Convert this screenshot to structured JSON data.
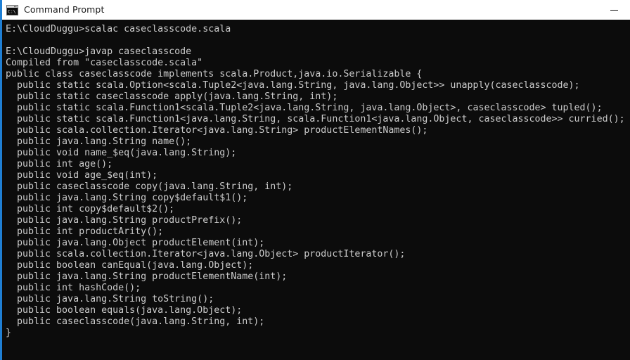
{
  "window": {
    "title": "Command Prompt",
    "icon": "console-window-icon",
    "icon_text": "C:\\",
    "accent_color": "#1f7fd4",
    "titlebar_bg": "#ffffff",
    "terminal_bg": "#0c0c0c",
    "terminal_fg": "#cccccc",
    "controls": [
      {
        "name": "minimize",
        "glyph": "—"
      }
    ]
  },
  "terminal": {
    "prompt_path": "E:\\CloudDuggu>",
    "lines": [
      "E:\\CloudDuggu>scalac caseclasscode.scala",
      "",
      "E:\\CloudDuggu>javap caseclasscode",
      "Compiled from \"caseclasscode.scala\"",
      "public class caseclasscode implements scala.Product,java.io.Serializable {",
      "  public static scala.Option<scala.Tuple2<java.lang.String, java.lang.Object>> unapply(caseclasscode);",
      "  public static caseclasscode apply(java.lang.String, int);",
      "  public static scala.Function1<scala.Tuple2<java.lang.String, java.lang.Object>, caseclasscode> tupled();",
      "  public static scala.Function1<java.lang.String, scala.Function1<java.lang.Object, caseclasscode>> curried();",
      "  public scala.collection.Iterator<java.lang.String> productElementNames();",
      "  public java.lang.String name();",
      "  public void name_$eq(java.lang.String);",
      "  public int age();",
      "  public void age_$eq(int);",
      "  public caseclasscode copy(java.lang.String, int);",
      "  public java.lang.String copy$default$1();",
      "  public int copy$default$2();",
      "  public java.lang.String productPrefix();",
      "  public int productArity();",
      "  public java.lang.Object productElement(int);",
      "  public scala.collection.Iterator<java.lang.Object> productIterator();",
      "  public boolean canEqual(java.lang.Object);",
      "  public java.lang.String productElementName(int);",
      "  public int hashCode();",
      "  public java.lang.String toString();",
      "  public boolean equals(java.lang.Object);",
      "  public caseclasscode(java.lang.String, int);",
      "}"
    ]
  }
}
